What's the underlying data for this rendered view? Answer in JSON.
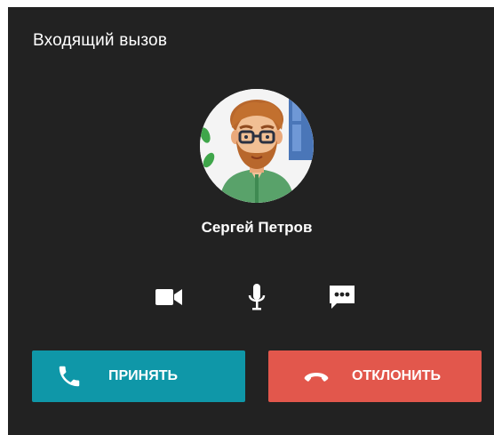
{
  "dialog": {
    "title": "Входящий вызов"
  },
  "caller": {
    "name": "Сергей Петров",
    "avatar_icon": "person-avatar"
  },
  "actions": [
    {
      "icon": "video-camera-icon"
    },
    {
      "icon": "microphone-icon"
    },
    {
      "icon": "chat-message-icon"
    }
  ],
  "buttons": {
    "accept_label": "ПРИНЯТЬ",
    "decline_label": "ОТКЛОНИТЬ"
  },
  "colors": {
    "background": "#222222",
    "accept": "#0f97a8",
    "decline": "#e2574c",
    "text": "#ffffff"
  }
}
